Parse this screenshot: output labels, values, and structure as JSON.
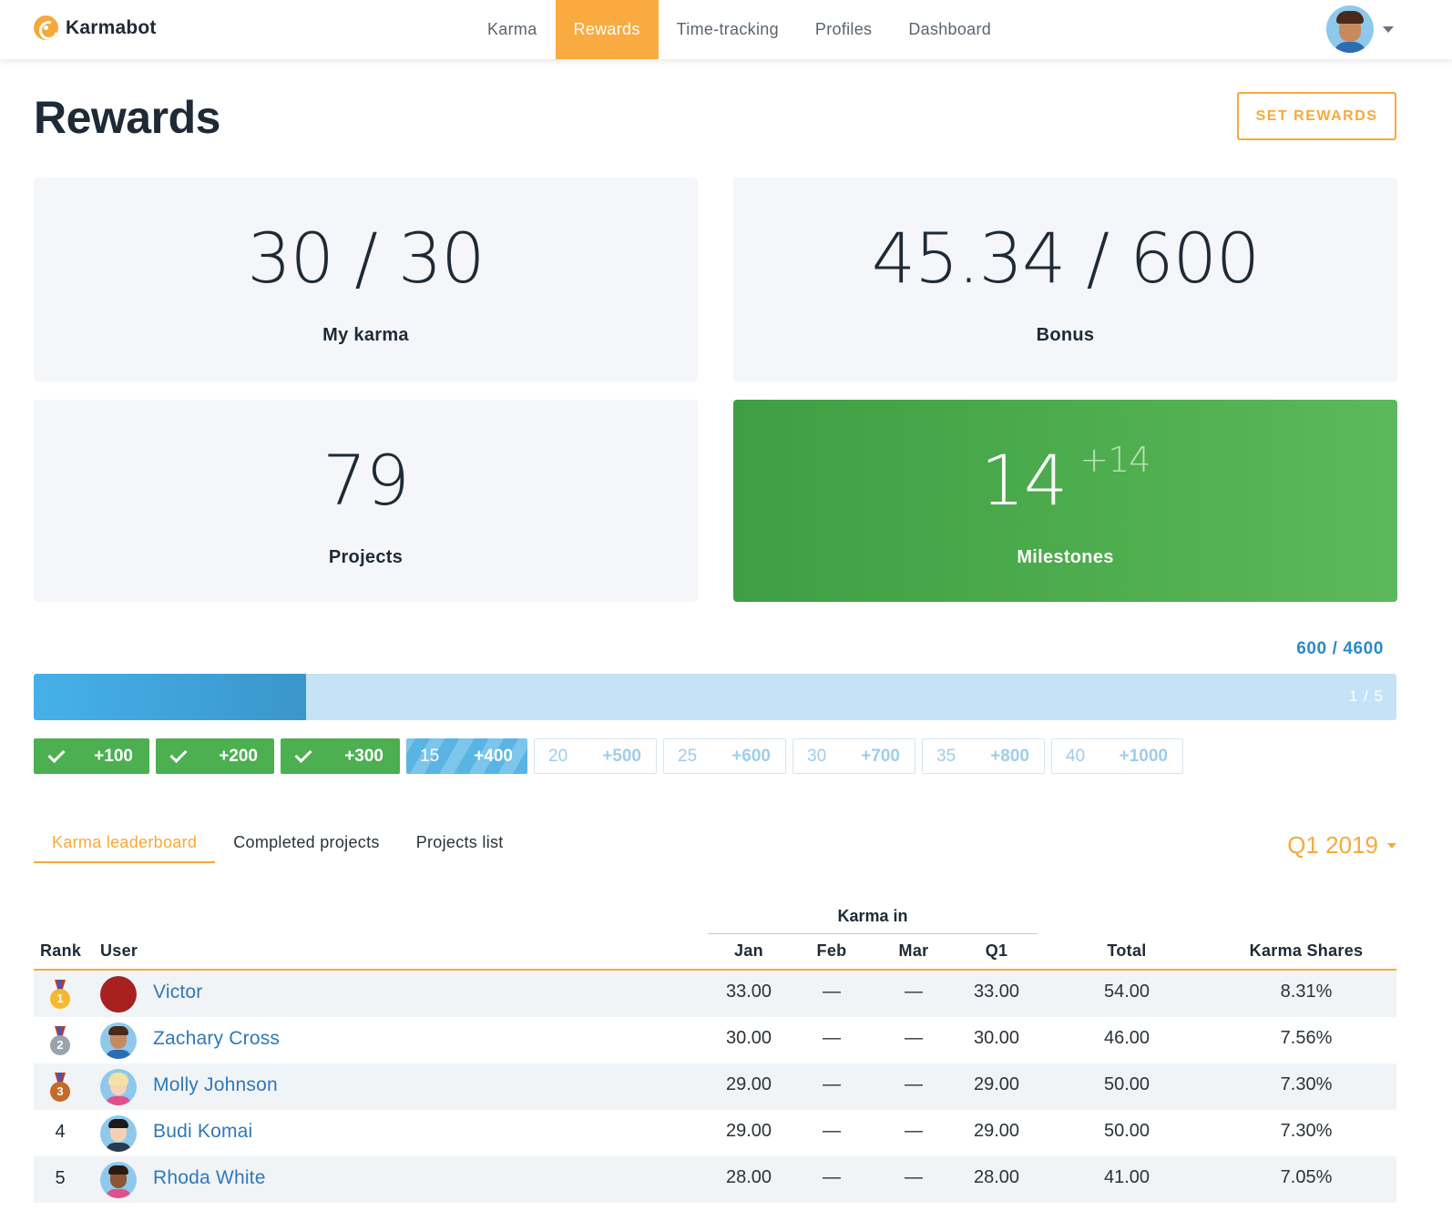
{
  "app": {
    "name": "Karmabot"
  },
  "nav": {
    "items": [
      {
        "label": "Karma"
      },
      {
        "label": "Rewards",
        "active": true
      },
      {
        "label": "Time-tracking"
      },
      {
        "label": "Profiles"
      },
      {
        "label": "Dashboard"
      }
    ]
  },
  "page": {
    "title": "Rewards",
    "set_rewards_label": "SET REWARDS"
  },
  "stats": {
    "karma": {
      "value": "30 / 30",
      "label": "My karma"
    },
    "bonus": {
      "value": "45.34 / 600",
      "label": "Bonus"
    },
    "projects": {
      "value": "79",
      "label": "Projects"
    },
    "milestones": {
      "value": "14",
      "delta": "+14",
      "label": "Milestones"
    }
  },
  "progress": {
    "label": "600 / 4600",
    "steps": "1 / 5",
    "fill_fraction": 0.2,
    "milestones": [
      {
        "state": "done",
        "amount": "+100"
      },
      {
        "state": "done",
        "amount": "+200"
      },
      {
        "state": "done",
        "amount": "+300"
      },
      {
        "state": "current",
        "count": "15",
        "amount": "+400"
      },
      {
        "state": "todo",
        "count": "20",
        "amount": "+500"
      },
      {
        "state": "todo",
        "count": "25",
        "amount": "+600"
      },
      {
        "state": "todo",
        "count": "30",
        "amount": "+700"
      },
      {
        "state": "todo",
        "count": "35",
        "amount": "+800"
      },
      {
        "state": "todo",
        "count": "40",
        "amount": "+1000"
      }
    ]
  },
  "tabs": [
    {
      "label": "Karma leaderboard",
      "active": true
    },
    {
      "label": "Completed projects"
    },
    {
      "label": "Projects list"
    }
  ],
  "period": {
    "label": "Q1 2019"
  },
  "table": {
    "group_header": "Karma in",
    "headers": {
      "rank": "Rank",
      "user": "User",
      "jan": "Jan",
      "feb": "Feb",
      "mar": "Mar",
      "q1": "Q1",
      "total": "Total",
      "shares": "Karma Shares"
    },
    "rows": [
      {
        "rank": "1",
        "name": "Victor",
        "jan": "33.00",
        "feb": "—",
        "mar": "—",
        "q1": "33.00",
        "total": "54.00",
        "shares": "8.31%"
      },
      {
        "rank": "2",
        "name": "Zachary Cross",
        "jan": "30.00",
        "feb": "—",
        "mar": "—",
        "q1": "30.00",
        "total": "46.00",
        "shares": "7.56%"
      },
      {
        "rank": "3",
        "name": "Molly Johnson",
        "jan": "29.00",
        "feb": "—",
        "mar": "—",
        "q1": "29.00",
        "total": "50.00",
        "shares": "7.30%"
      },
      {
        "rank": "4",
        "name": "Budi Komai",
        "jan": "29.00",
        "feb": "—",
        "mar": "—",
        "q1": "29.00",
        "total": "50.00",
        "shares": "7.30%"
      },
      {
        "rank": "5",
        "name": "Rhoda White",
        "jan": "28.00",
        "feb": "—",
        "mar": "—",
        "q1": "28.00",
        "total": "41.00",
        "shares": "7.05%"
      }
    ]
  },
  "colors": {
    "accent": "#f6a93b",
    "success": "#4caf50",
    "progress": "#45b1e8",
    "link": "#2f78b8",
    "gold": "#f5b82e",
    "silver": "#9aa3ab",
    "bronze": "#c46a2a"
  }
}
